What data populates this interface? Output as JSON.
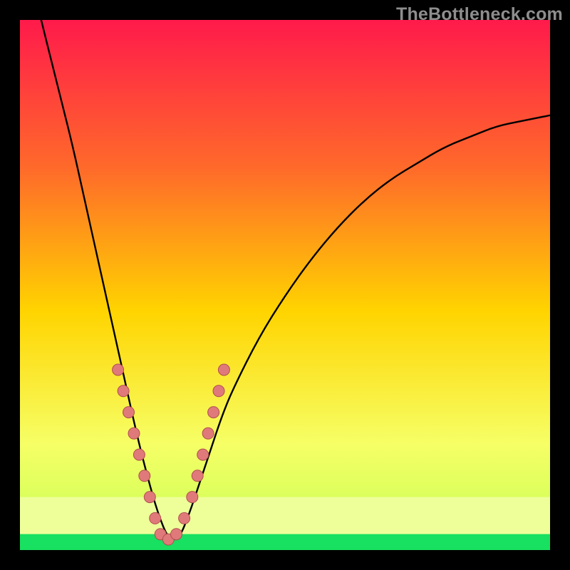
{
  "watermark": "TheBottleneck.com",
  "colors": {
    "bg": "#000000",
    "curve": "#000000",
    "dot_fill": "#e07a7a",
    "dot_stroke": "#b04f4f",
    "grad_top": "#ff1a4b",
    "grad_upper": "#ff6a2a",
    "grad_mid": "#ffd400",
    "grad_low": "#f6ff66",
    "grad_band": "#d7ff5a",
    "grad_green": "#18e060"
  },
  "chart_data": {
    "type": "line",
    "title": "",
    "xlabel": "",
    "ylabel": "",
    "xlim": [
      0,
      100
    ],
    "ylim": [
      0,
      100
    ],
    "x_min_at": 28,
    "series": [
      {
        "name": "bottleneck-curve",
        "x": [
          4,
          6,
          8,
          10,
          12,
          14,
          16,
          18,
          20,
          22,
          24,
          26,
          28,
          30,
          32,
          34,
          36,
          38,
          40,
          45,
          50,
          55,
          60,
          65,
          70,
          75,
          80,
          85,
          90,
          95,
          100
        ],
        "y": [
          100,
          92,
          84,
          76,
          67,
          58,
          49,
          40,
          31,
          22,
          14,
          7,
          2,
          2,
          7,
          13,
          19,
          25,
          30,
          40,
          48,
          55,
          61,
          66,
          70,
          73,
          76,
          78,
          80,
          81,
          82
        ]
      }
    ],
    "dots": {
      "name": "highlight-dots",
      "x": [
        18.5,
        19.5,
        20.5,
        21.5,
        22.5,
        23.5,
        24.5,
        25.5,
        26.5,
        28,
        29.5,
        31,
        32.5,
        33.5,
        34.5,
        35.5,
        36.5,
        37.5,
        38.5
      ],
      "y": [
        34,
        30,
        26,
        22,
        18,
        14,
        10,
        6,
        3,
        2,
        3,
        6,
        10,
        14,
        18,
        22,
        26,
        30,
        34
      ]
    },
    "green_band": {
      "y0": 0,
      "y1": 3
    },
    "pale_band": {
      "y0": 3,
      "y1": 10
    }
  }
}
